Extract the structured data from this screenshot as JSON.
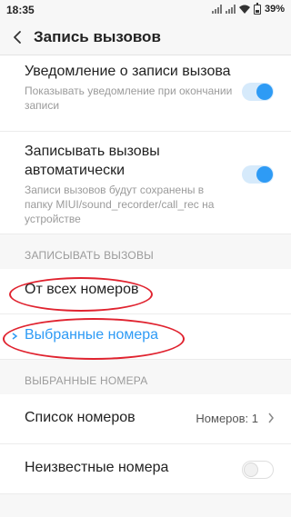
{
  "status_bar": {
    "time": "18:35",
    "battery": "39%"
  },
  "header": {
    "title": "Запись вызовов"
  },
  "settings": [
    {
      "title": "Уведомление о записи вызова",
      "description": "Показывать уведомление при окончании записи",
      "toggle": "on"
    },
    {
      "title": "Записывать вызовы автоматически",
      "description": "Записи вызовов будут сохранены в папку MIUI/sound_recorder/call_rec на устройстве",
      "toggle": "on"
    }
  ],
  "record_section": {
    "label": "ЗАПИСЫВАТЬ ВЫЗОВЫ",
    "options": [
      {
        "label": "От всех номеров",
        "selected": false
      },
      {
        "label": "Выбранные номера",
        "selected": true
      }
    ]
  },
  "selected_section": {
    "label": "ВЫБРАННЫЕ НОМЕРА",
    "number_list": {
      "label": "Список номеров",
      "value": "Номеров: 1"
    },
    "unknown_numbers": {
      "label": "Неизвестные номера",
      "toggle": "off"
    }
  },
  "colors": {
    "accent": "#2e9bf5",
    "annotation": "#e0232f"
  }
}
